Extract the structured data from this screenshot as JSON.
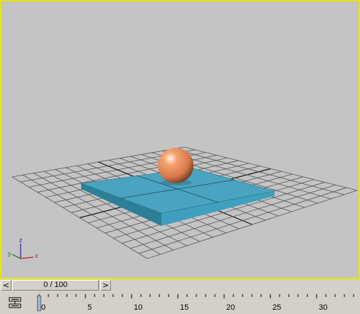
{
  "viewport": {
    "border_color": "#e6e600",
    "background_color": "#c4c4c4",
    "axis_tripod": {
      "z_label": "z",
      "y_label": "y",
      "x_label": "x"
    },
    "objects": [
      {
        "name": "sphere",
        "color": "#e8865a"
      },
      {
        "name": "box",
        "color": "#4aa3bf"
      },
      {
        "name": "grid",
        "color": "#444444"
      }
    ]
  },
  "time_slider": {
    "prev_icon": "chevron-left-icon",
    "next_icon": "chevron-right-icon",
    "prev_glyph": "<",
    "next_glyph": ">",
    "label": "0 / 100",
    "current_frame": 0,
    "total_frames": 100
  },
  "track_bar": {
    "toggle_icon": "curve-editor-icon",
    "tick_labels": [
      "0",
      "5",
      "10",
      "15",
      "20",
      "25",
      "30"
    ],
    "current_frame": 0
  }
}
